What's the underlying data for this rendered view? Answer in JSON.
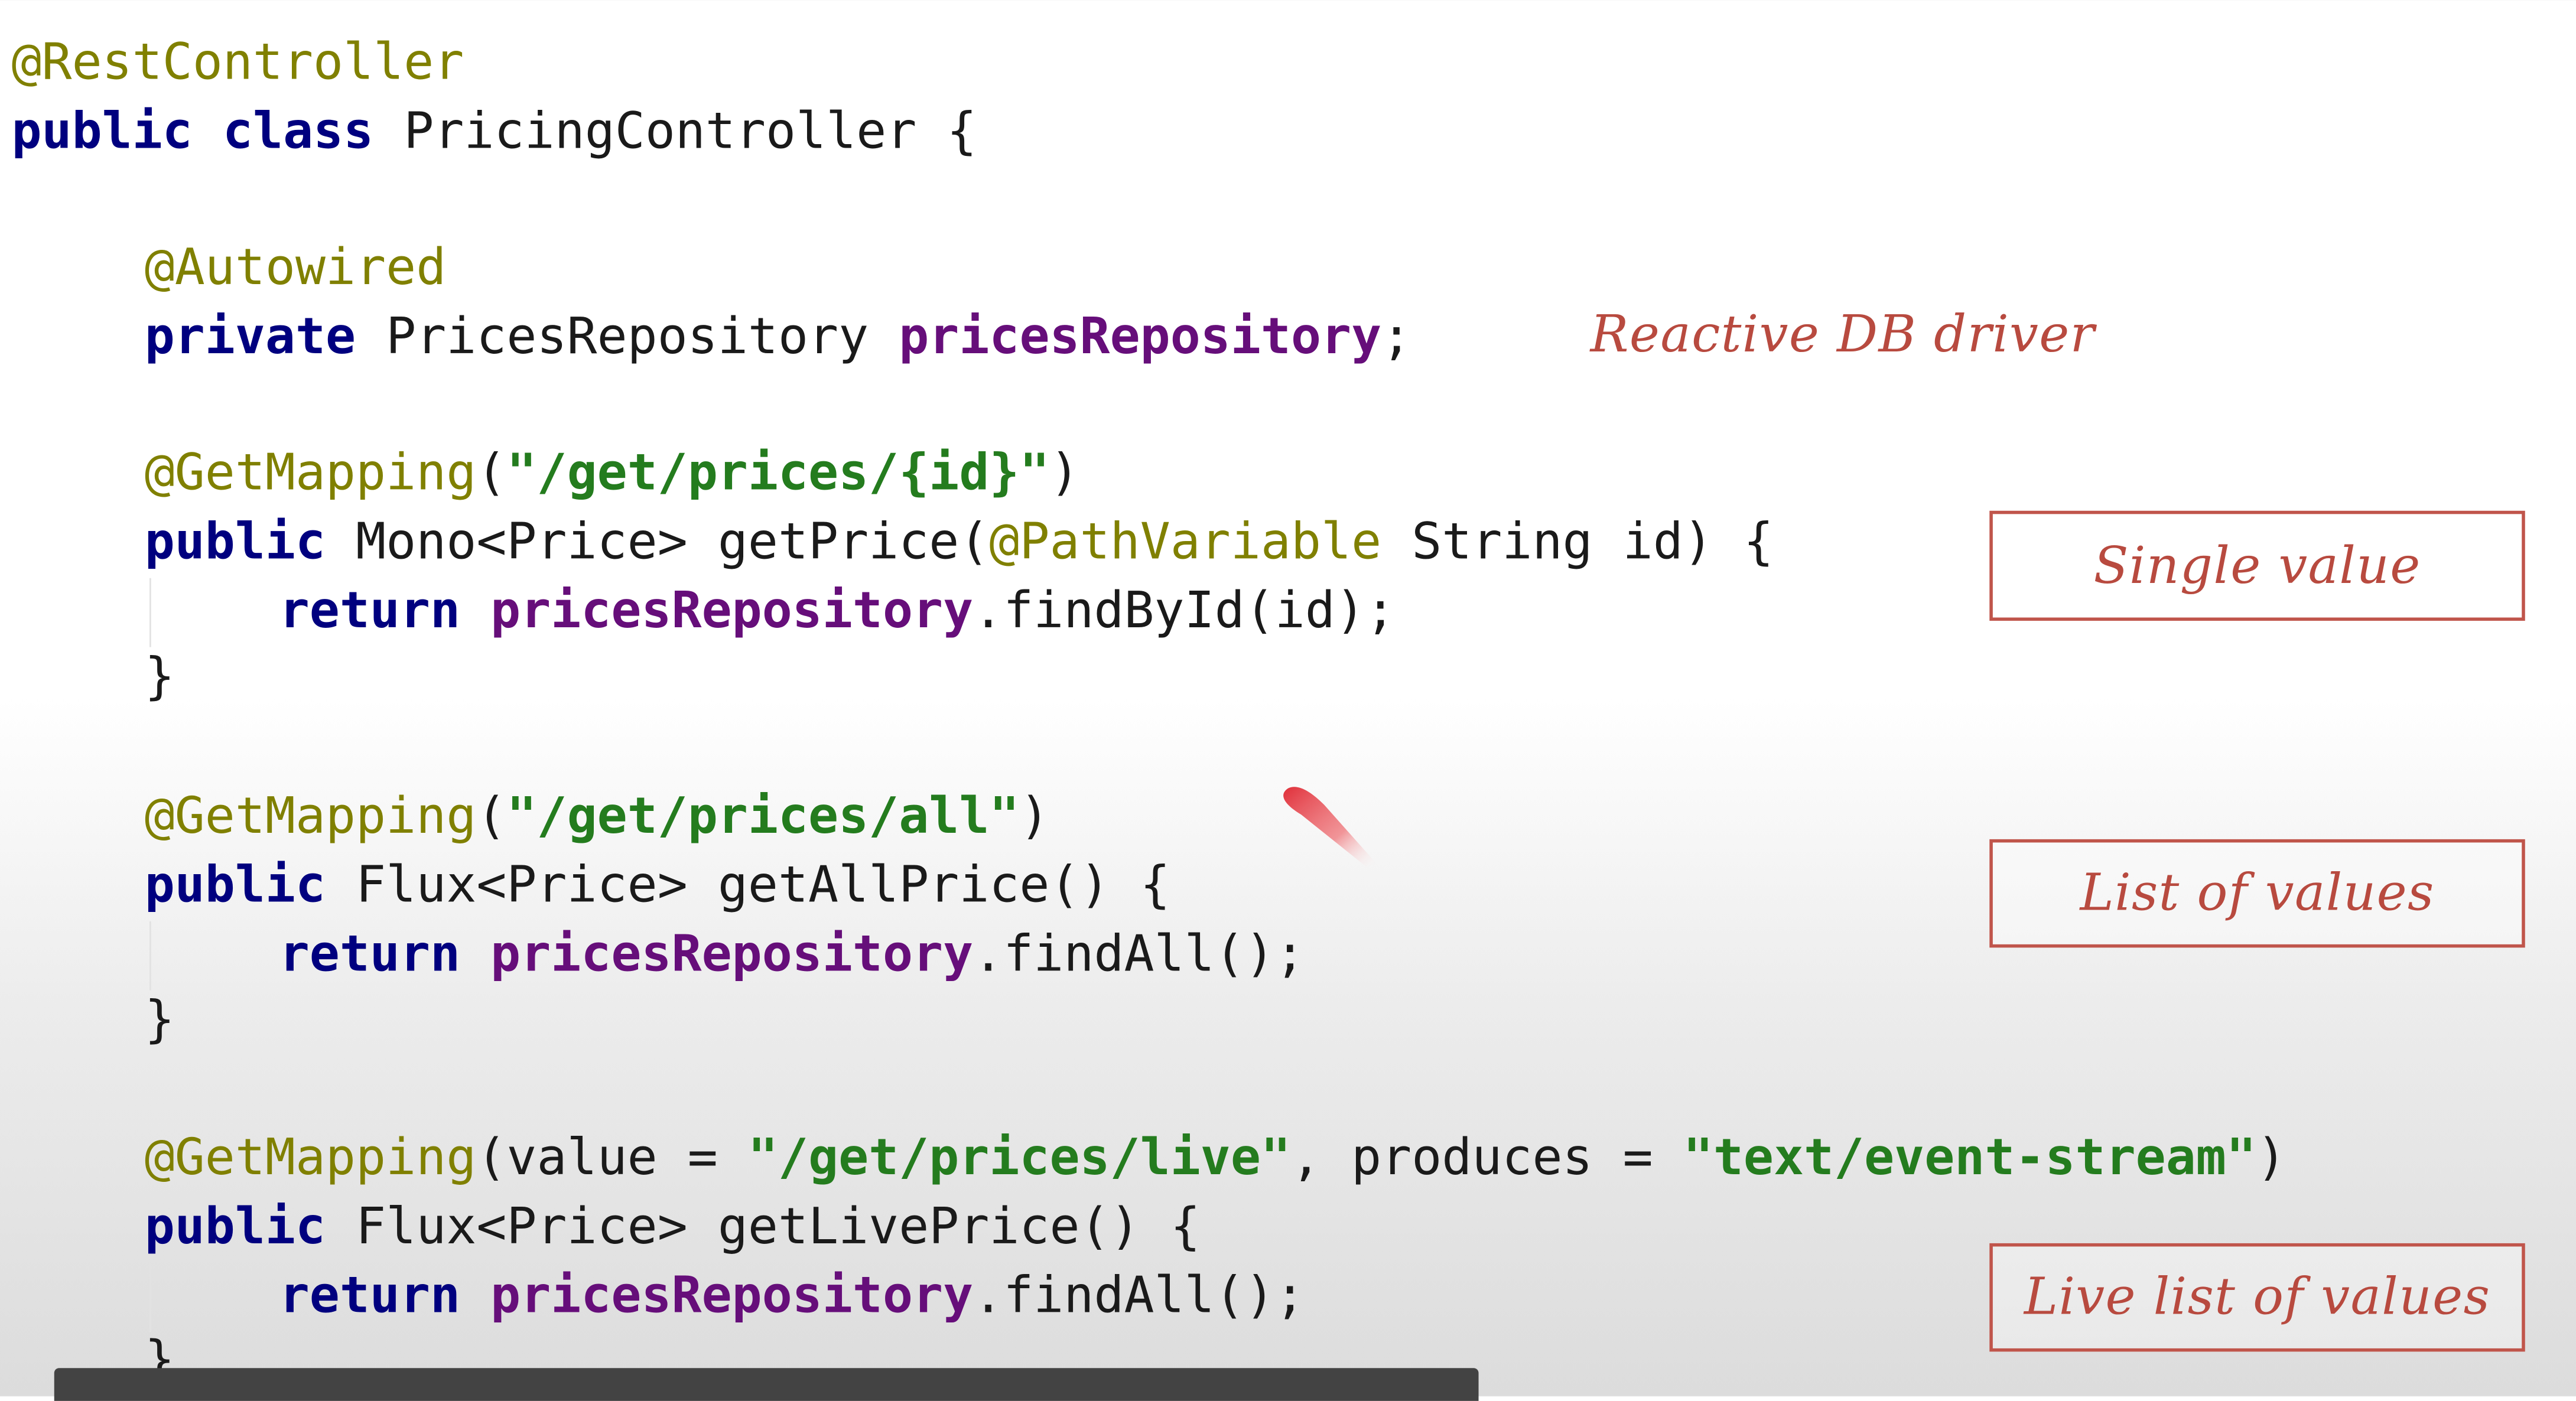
{
  "code": {
    "class_annotation": "@RestController",
    "class_public": "public",
    "class_kw": "class",
    "class_name": " PricingController {",
    "autowired": "@Autowired",
    "private_kw": "private",
    "repo_type": " PricesRepository ",
    "repo_field": "pricesRepository",
    "semicolon": ";",
    "m1": {
      "annotation": "@GetMapping",
      "paren_open": "(",
      "path": "\"/get/prices/{id}\"",
      "paren_close": ")",
      "public_kw": "public",
      "sig_a": " Mono<Price> getPrice(",
      "path_variable": "@PathVariable",
      "sig_b": " String id) {",
      "return_kw": "return",
      "repo": "pricesRepository",
      "call": ".findById(id);",
      "close": "}"
    },
    "m2": {
      "annotation": "@GetMapping",
      "paren_open": "(",
      "path": "\"/get/prices/all\"",
      "paren_close": ")",
      "public_kw": "public",
      "sig": " Flux<Price> getAllPrice() {",
      "return_kw": "return",
      "repo": "pricesRepository",
      "call": ".findAll();",
      "close": "}"
    },
    "m3": {
      "annotation": "@GetMapping",
      "value_part": "(value = ",
      "path": "\"/get/prices/live\"",
      "produces_part": ", produces = ",
      "media_type": "\"text/event-stream\"",
      "paren_close": ")",
      "public_kw": "public",
      "sig": " Flux<Price> getLivePrice() {",
      "return_kw": "return",
      "repo": "pricesRepository",
      "call": ".findAll();",
      "close": "}"
    }
  },
  "annotations": {
    "reactive_db_driver": "Reactive DB driver",
    "single_value": "Single value",
    "list_of_values": "List of values",
    "live_list_of_values": "Live list of values"
  },
  "colors": {
    "annotation": "#808000",
    "keyword": "#00007f",
    "field": "#660e7a",
    "string": "#247c1e",
    "note_red": "#b84a3f",
    "pointer_red": "#e0303a"
  },
  "icons": {
    "pointer": "laser-pointer-icon"
  }
}
